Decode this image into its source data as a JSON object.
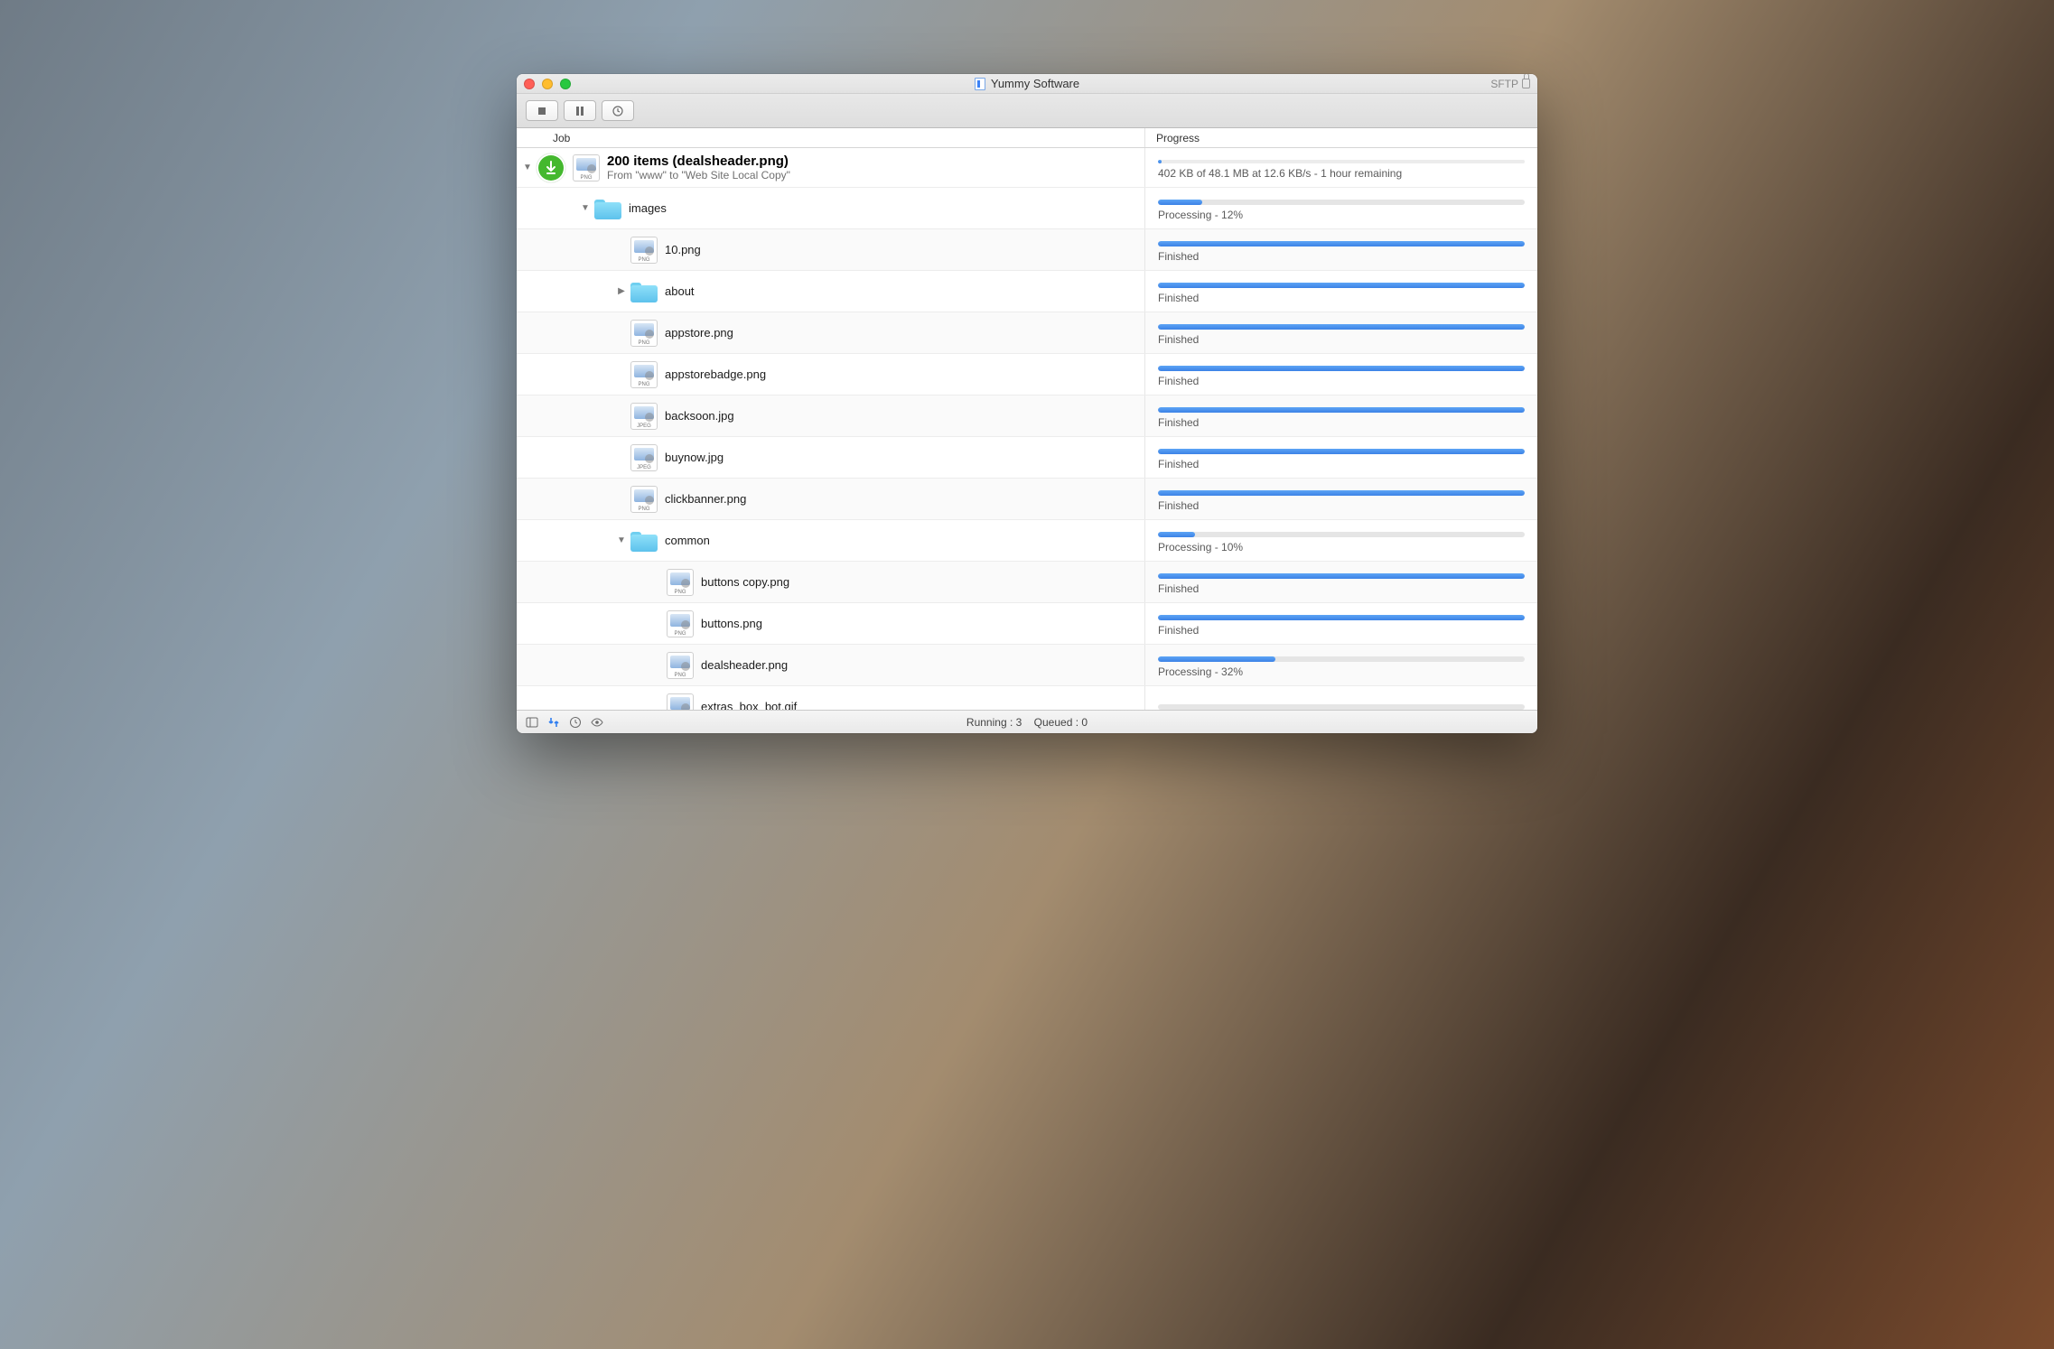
{
  "window": {
    "title": "Yummy Software",
    "protocol": "SFTP"
  },
  "columns": {
    "job": "Job",
    "progress": "Progress"
  },
  "job": {
    "title": "200 items (dealsheader.png)",
    "subtitle": "From \"www\" to \"Web Site Local Copy\"",
    "overall_status": "402 KB of 48.1 MB at 12.6 KB/s - 1 hour remaining",
    "overall_percent": 1
  },
  "rows": [
    {
      "type": "folder",
      "depth": 1,
      "expanded": true,
      "name": "images",
      "status": "Processing - 12%",
      "percent": 12
    },
    {
      "type": "file",
      "depth": 2,
      "ext": "PNG",
      "name": "10.png",
      "status": "Finished",
      "percent": 100
    },
    {
      "type": "folder",
      "depth": 2,
      "expanded": false,
      "name": "about",
      "status": "Finished",
      "percent": 100
    },
    {
      "type": "file",
      "depth": 2,
      "ext": "PNG",
      "name": "appstore.png",
      "status": "Finished",
      "percent": 100
    },
    {
      "type": "file",
      "depth": 2,
      "ext": "PNG",
      "name": "appstorebadge.png",
      "status": "Finished",
      "percent": 100
    },
    {
      "type": "file",
      "depth": 2,
      "ext": "JPEG",
      "name": "backsoon.jpg",
      "status": "Finished",
      "percent": 100
    },
    {
      "type": "file",
      "depth": 2,
      "ext": "JPEG",
      "name": "buynow.jpg",
      "status": "Finished",
      "percent": 100
    },
    {
      "type": "file",
      "depth": 2,
      "ext": "PNG",
      "name": "clickbanner.png",
      "status": "Finished",
      "percent": 100
    },
    {
      "type": "folder",
      "depth": 2,
      "expanded": true,
      "name": "common",
      "status": "Processing - 10%",
      "percent": 10
    },
    {
      "type": "file",
      "depth": 3,
      "ext": "PNG",
      "name": "buttons copy.png",
      "status": "Finished",
      "percent": 100
    },
    {
      "type": "file",
      "depth": 3,
      "ext": "PNG",
      "name": "buttons.png",
      "status": "Finished",
      "percent": 100
    },
    {
      "type": "file",
      "depth": 3,
      "ext": "PNG",
      "name": "dealsheader.png",
      "status": "Processing - 32%",
      "percent": 32
    },
    {
      "type": "file",
      "depth": 3,
      "ext": "GIF",
      "name": "extras_box_bot.gif",
      "status": "",
      "percent": 0
    }
  ],
  "footer": {
    "running_label": "Running :",
    "running_count": "3",
    "queued_label": "Queued :",
    "queued_count": "0"
  }
}
